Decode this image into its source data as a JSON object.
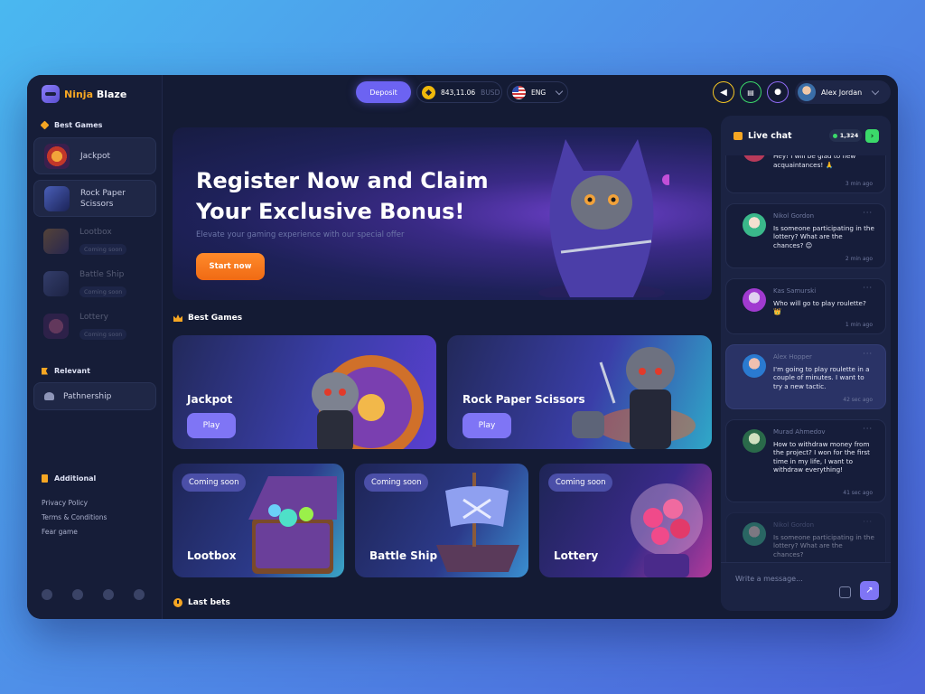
{
  "brand": {
    "name_part1": "Ninja",
    "name_part2": "Blaze"
  },
  "sidebar": {
    "best_games_title": "Best Games",
    "games": [
      {
        "label": "Jackpot",
        "status": ""
      },
      {
        "label": "Rock Paper Scissors",
        "status": ""
      },
      {
        "label": "Lootbox",
        "status": "Coming soon"
      },
      {
        "label": "Battle Ship",
        "status": "Coming soon"
      },
      {
        "label": "Lottery",
        "status": "Coming soon"
      }
    ],
    "relevant_title": "Relevant",
    "relevant_items": [
      {
        "label": "Pathnership"
      }
    ],
    "additional_title": "Additional",
    "links": [
      "Privacy Policy",
      "Terms & Conditions",
      "Fear game"
    ],
    "socials": [
      "twitter-icon",
      "telegram-icon",
      "facebook-icon",
      "discord-icon"
    ]
  },
  "topbar": {
    "deposit_label": "Deposit",
    "balance": "843,11.06",
    "currency": "BUSD",
    "language": "ENG",
    "user_name": "Alex Jordan"
  },
  "hero": {
    "title": "Register Now and Claim Your Exclusive Bonus!",
    "subtitle": "Elevate your gaming experience with our special offer",
    "cta": "Start now"
  },
  "main": {
    "best_games_title": "Best Games",
    "featured": [
      {
        "name": "Jackpot",
        "action": "Play"
      },
      {
        "name": "Rock Paper Scissors",
        "action": "Play"
      }
    ],
    "upcoming": [
      {
        "name": "Lootbox",
        "badge": "Coming soon"
      },
      {
        "name": "Battle Ship",
        "badge": "Coming soon"
      },
      {
        "name": "Lottery",
        "badge": "Coming soon"
      }
    ],
    "last_bets_title": "Last bets"
  },
  "chat": {
    "title": "Live chat",
    "online_count": "1,324",
    "messages": [
      {
        "user": "",
        "text": "Hey! I will be glad to new acquaintances! 🙏",
        "time": "3 min ago"
      },
      {
        "user": "Nikol Gordon",
        "text": "Is someone participating in the lottery? What are the chances? 😊",
        "time": "2 min ago"
      },
      {
        "user": "Kas Samurski",
        "text": "Who will go to play roulette? 👑",
        "time": "1 min ago"
      },
      {
        "user": "Alex Hopper",
        "text": "I'm going to play roulette in a couple of minutes. I want to try a new tactic.",
        "time": "42 sec ago"
      },
      {
        "user": "Murad Ahmedov",
        "text": "How to withdraw money from the project? I won for the first time in my life, I want to withdraw everything!",
        "time": "41 sec ago"
      },
      {
        "user": "Nikol Gordon",
        "text": "Is someone participating in the lottery? What are the chances?",
        "time": ""
      }
    ],
    "input_placeholder": "Write a message..."
  },
  "colors": {
    "accent": "#7f75f5",
    "orange": "#f5a623",
    "online": "#3bd96a",
    "bg": "#141b34"
  }
}
